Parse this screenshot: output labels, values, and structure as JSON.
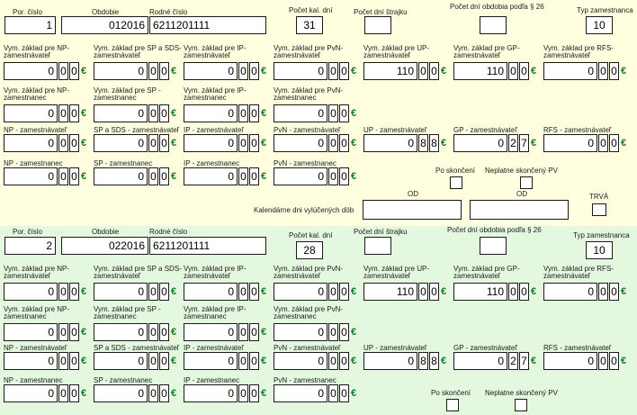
{
  "labels": {
    "por_cislo": "Por. číslo",
    "obdobie": "Obdobie",
    "rodne_cislo": "Rodné číslo",
    "pocet_kal_dni": "Počet kal. dní",
    "pocet_dni_strajku": "Počet dní štrajku",
    "pocet_dni_26": "Počet dní obdobia podľa § 26",
    "typ_zamestnanca": "Typ zamestnanca",
    "vz_np_zl1": "Vym. základ pre NP-",
    "vz_sp_zl1": "Vym. základ pre SP a SDS-",
    "vz_ip_zl1": "Vym. základ pre IP-",
    "vz_pvn_zl1": "Vym. základ pre PvN-",
    "vz_up_zl1": "Vym. základ pre UP-",
    "vz_gp_zl1": "Vym. základ pre GP-",
    "vz_rfs_zl1": "Vym. základ pre RFS-",
    "zamestnavatel": "zamestnávateľ",
    "vz_np_zc1": "Vym. základ pre NP-",
    "vz_sp_zc1": "Vym. základ pre SP -",
    "vz_ip_zc1": "Vym. základ pre IP-",
    "vz_pvn_zc1": "Vym. základ pre PvN-",
    "zamestnanec": "zamestnanec",
    "np_zl": "NP - zamestnávateľ",
    "sp_zl": "SP a SDS - zamestnávateľ",
    "ip_zl": "IP - zamestnávateľ",
    "pvn_zl": "PvN - zamestnávateľ",
    "up_zl": "UP - zamestnávateľ",
    "gp_zl": "GP - zamestnávateľ",
    "rfs_zl": "RFS - zamestnávateľ",
    "np_zc": "NP - zamestnanec",
    "sp_zc": "SP - zamestnanec",
    "ip_zc": "IP - zamestnanec",
    "pvn_zc": "PvN - zamestnanec",
    "po_skonceni": "Po skončení",
    "neplatne_pv": "Neplatne skončený PV",
    "kal_dni_vylucenych": "Kalendárne dni vylúčených döb",
    "od": "OD",
    "trva": "TRVÁ"
  },
  "currency": "€",
  "records": [
    {
      "por_cislo": "1",
      "obdobie": "012016",
      "rodne_cislo": "6211201111",
      "pocet_kal_dni": "31",
      "pocet_dni_strajku": "",
      "pocet_dni_26": "",
      "typ_zamestnanca": "10",
      "vz_zamestnavatel": [
        {
          "int": "0",
          "dec": [
            "0",
            "0"
          ]
        },
        {
          "int": "0",
          "dec": [
            "0",
            "0"
          ]
        },
        {
          "int": "0",
          "dec": [
            "0",
            "0"
          ]
        },
        {
          "int": "0",
          "dec": [
            "0",
            "0"
          ]
        },
        {
          "int": "110",
          "dec": [
            "0",
            "0"
          ]
        },
        {
          "int": "110",
          "dec": [
            "0",
            "0"
          ]
        },
        {
          "int": "0",
          "dec": [
            "0",
            "0"
          ]
        }
      ],
      "vz_zamestnanec": [
        {
          "int": "0",
          "dec": [
            "0",
            "0"
          ]
        },
        {
          "int": "0",
          "dec": [
            "0",
            "0"
          ]
        },
        {
          "int": "0",
          "dec": [
            "0",
            "0"
          ]
        },
        {
          "int": "0",
          "dec": [
            "0",
            "0"
          ]
        }
      ],
      "odvod_zamestnavatel": [
        {
          "int": "0",
          "dec": [
            "0",
            "0"
          ]
        },
        {
          "int": "0",
          "dec": [
            "0",
            "0"
          ]
        },
        {
          "int": "0",
          "dec": [
            "0",
            "0"
          ]
        },
        {
          "int": "0",
          "dec": [
            "0",
            "0"
          ]
        },
        {
          "int": "0",
          "dec": [
            "8",
            "8"
          ]
        },
        {
          "int": "0",
          "dec": [
            "2",
            "7"
          ]
        },
        {
          "int": "0",
          "dec": [
            "0",
            "0"
          ]
        }
      ],
      "odvod_zamestnanec": [
        {
          "int": "0",
          "dec": [
            "0",
            "0"
          ]
        },
        {
          "int": "0",
          "dec": [
            "0",
            "0"
          ]
        },
        {
          "int": "0",
          "dec": [
            "0",
            "0"
          ]
        },
        {
          "int": "0",
          "dec": [
            "0",
            "0"
          ]
        }
      ]
    },
    {
      "por_cislo": "2",
      "obdobie": "022016",
      "rodne_cislo": "6211201111",
      "pocet_kal_dni": "28",
      "pocet_dni_strajku": "",
      "pocet_dni_26": "",
      "typ_zamestnanca": "10",
      "vz_zamestnavatel": [
        {
          "int": "0",
          "dec": [
            "0",
            "0"
          ]
        },
        {
          "int": "0",
          "dec": [
            "0",
            "0"
          ]
        },
        {
          "int": "0",
          "dec": [
            "0",
            "0"
          ]
        },
        {
          "int": "0",
          "dec": [
            "0",
            "0"
          ]
        },
        {
          "int": "110",
          "dec": [
            "0",
            "0"
          ]
        },
        {
          "int": "110",
          "dec": [
            "0",
            "0"
          ]
        },
        {
          "int": "0",
          "dec": [
            "0",
            "0"
          ]
        }
      ],
      "vz_zamestnanec": [
        {
          "int": "0",
          "dec": [
            "0",
            "0"
          ]
        },
        {
          "int": "0",
          "dec": [
            "0",
            "0"
          ]
        },
        {
          "int": "0",
          "dec": [
            "0",
            "0"
          ]
        },
        {
          "int": "0",
          "dec": [
            "0",
            "0"
          ]
        }
      ],
      "odvod_zamestnavatel": [
        {
          "int": "0",
          "dec": [
            "0",
            "0"
          ]
        },
        {
          "int": "0",
          "dec": [
            "0",
            "0"
          ]
        },
        {
          "int": "0",
          "dec": [
            "0",
            "0"
          ]
        },
        {
          "int": "0",
          "dec": [
            "0",
            "0"
          ]
        },
        {
          "int": "0",
          "dec": [
            "8",
            "8"
          ]
        },
        {
          "int": "0",
          "dec": [
            "2",
            "7"
          ]
        },
        {
          "int": "0",
          "dec": [
            "0",
            "0"
          ]
        }
      ],
      "odvod_zamestnanec": [
        {
          "int": "0",
          "dec": [
            "0",
            "0"
          ]
        },
        {
          "int": "0",
          "dec": [
            "0",
            "0"
          ]
        },
        {
          "int": "0",
          "dec": [
            "0",
            "0"
          ]
        },
        {
          "int": "0",
          "dec": [
            "0",
            "0"
          ]
        }
      ]
    }
  ],
  "colors": {
    "section1_bg": "#ffffe0",
    "section2_bg": "#e4f8e0",
    "euro": "#127a2b"
  }
}
